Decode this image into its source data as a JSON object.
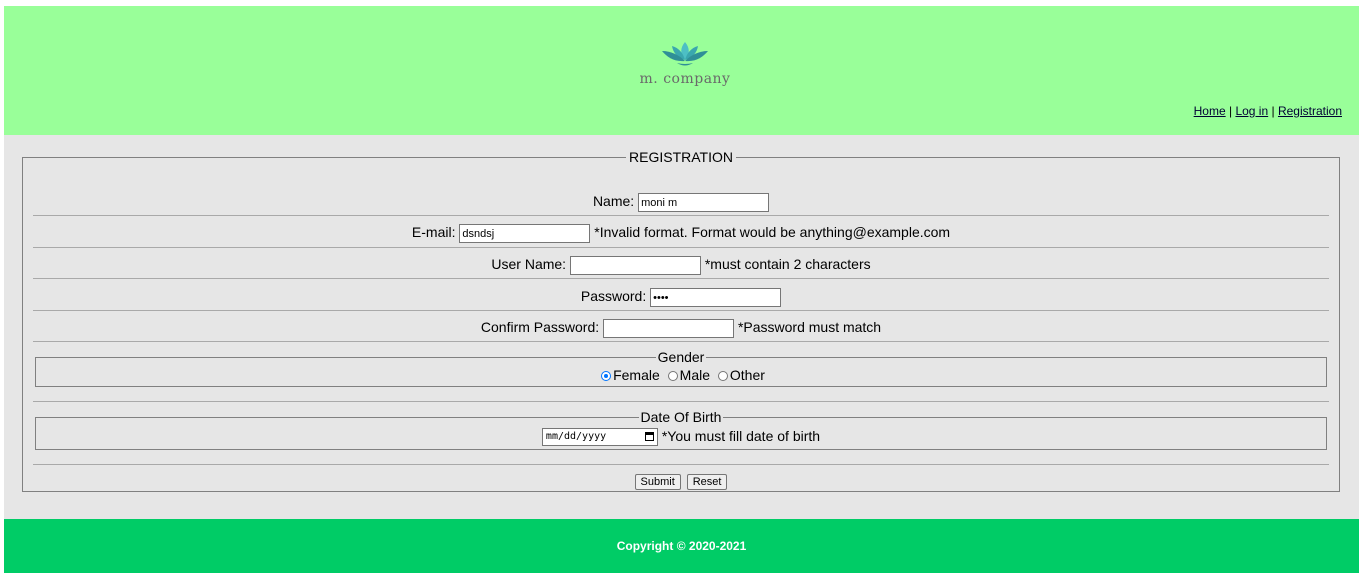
{
  "header": {
    "logo_text": "m. company",
    "nav": {
      "home": "Home",
      "sep1": "|",
      "login": "Log in",
      "sep2": "|",
      "registration": "Registration"
    }
  },
  "form": {
    "legend": "REGISTRATION",
    "name": {
      "label": "Name:",
      "value": "moni m"
    },
    "email": {
      "label": "E-mail:",
      "value": "dsndsj",
      "error": "*Invalid format. Format would be anything@example.com"
    },
    "username": {
      "label": "User Name:",
      "value": "",
      "error": "*must contain 2 characters"
    },
    "password": {
      "label": "Password:",
      "value": "••••"
    },
    "confirm": {
      "label": "Confirm Password:",
      "value": "",
      "error": "*Password must match"
    },
    "gender": {
      "legend": "Gender",
      "options": [
        "Female",
        "Male",
        "Other"
      ],
      "selected": "Female"
    },
    "dob": {
      "legend": "Date Of Birth",
      "placeholder": "mm/dd/yyyy",
      "error": "*You must fill date of birth"
    },
    "submit": "Submit",
    "reset": "Reset"
  },
  "footer": {
    "text": "Copyright © 2020-2021"
  },
  "colors": {
    "header": "#99ff99",
    "main": "#e6e6e6",
    "footer": "#00cc66",
    "radio_accent": "#0075ff"
  }
}
